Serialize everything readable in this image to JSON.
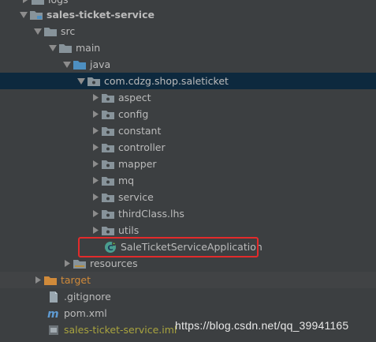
{
  "tree": {
    "logs": "logs",
    "module": "sales-ticket-service",
    "src": "src",
    "main": "main",
    "java": "java",
    "package": "com.cdzg.shop.saleticket",
    "subpackages": [
      "aspect",
      "config",
      "constant",
      "controller",
      "mapper",
      "mq",
      "service",
      "thirdClass.lhs",
      "utils"
    ],
    "app_class": "SaleTicketServiceApplication",
    "resources": "resources",
    "target": "target",
    "gitignore": ".gitignore",
    "pom": "pom.xml",
    "iml": "sales-ticket-service.iml"
  },
  "watermark": "https://blog.csdn.net/qq_39941165",
  "colors": {
    "background": "#3c3f41",
    "selection": "#0d293e",
    "folder": "#87939a",
    "source_folder": "#4d8fc1",
    "excluded_folder": "#d08a3a",
    "highlight_box": "#e32b2b"
  }
}
